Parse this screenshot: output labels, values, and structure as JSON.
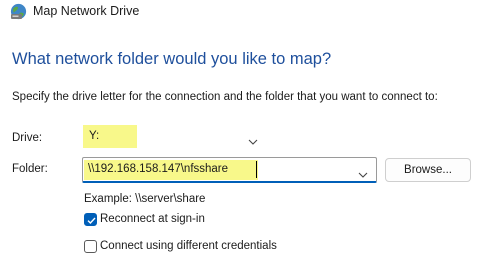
{
  "window": {
    "title": "Map Network Drive",
    "icon": "network-drive-icon"
  },
  "heading": "What network folder would you like to map?",
  "instructions": "Specify the drive letter for the connection and the folder that you want to connect to:",
  "drive": {
    "label": "Drive:",
    "value": "Y:"
  },
  "folder": {
    "label": "Folder:",
    "value": "\\\\192.168.158.147\\nfsshare"
  },
  "browse_label": "Browse...",
  "example": "Example: \\\\server\\share",
  "options": [
    {
      "label": "Reconnect at sign-in",
      "checked": true
    },
    {
      "label": "Connect using different credentials",
      "checked": false
    }
  ],
  "colors": {
    "heading": "#1e4f9c",
    "highlight": "#f8f88a",
    "accent": "#005fb8"
  }
}
